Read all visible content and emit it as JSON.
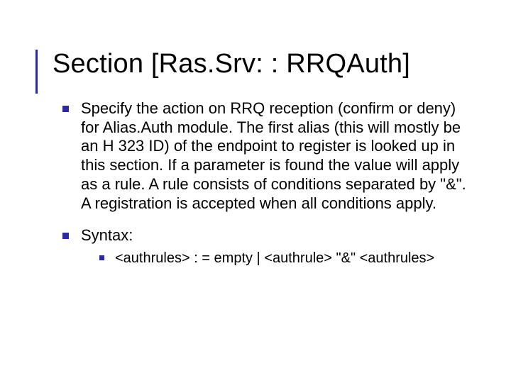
{
  "title": "Section [Ras.Srv: : RRQAuth]",
  "bullets": [
    {
      "text": "Specify the action on RRQ reception (confirm or deny) for Alias.Auth module. The first alias (this will mostly be an H 323 ID) of the endpoint to register is looked up in this section. If a parameter is found the value will apply as a rule. A rule consists of conditions separated by \"&\". A registration is accepted when all conditions apply."
    },
    {
      "text": "Syntax:",
      "sub": [
        {
          "text": "<authrules> : =  empty  |  <authrule> \"&\" <authrules>"
        }
      ]
    }
  ]
}
